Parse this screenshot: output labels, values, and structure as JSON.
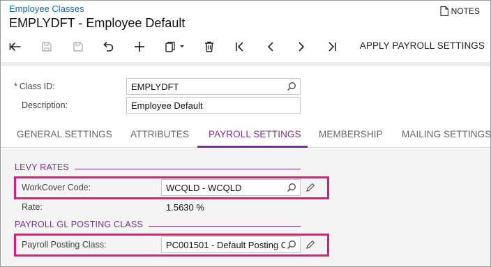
{
  "header": {
    "breadcrumb": "Employee Classes",
    "title": "EMPLYDFT - Employee Default",
    "notes_label": "NOTES"
  },
  "toolbar": {
    "buttons": [
      {
        "icon": "back-arrow-icon",
        "enabled": true
      },
      {
        "icon": "save-close-icon",
        "enabled": false
      },
      {
        "icon": "save-icon",
        "enabled": false
      },
      {
        "icon": "undo-icon",
        "enabled": true
      },
      {
        "icon": "add-icon",
        "enabled": true
      },
      {
        "icon": "copy-paste-icon",
        "enabled": true
      },
      {
        "icon": "delete-icon",
        "enabled": true
      },
      {
        "icon": "first-record-icon",
        "enabled": true
      },
      {
        "icon": "previous-record-icon",
        "enabled": true
      },
      {
        "icon": "next-record-icon",
        "enabled": true
      },
      {
        "icon": "last-record-icon",
        "enabled": true
      }
    ],
    "apply_label": "APPLY PAYROLL SETTINGS"
  },
  "form": {
    "required_mark": "*",
    "class_id_label": "Class ID:",
    "class_id_value": "EMPLYDFT",
    "description_label": "Description:",
    "description_value": "Employee Default"
  },
  "tabs": [
    {
      "label": "GENERAL SETTINGS",
      "active": false
    },
    {
      "label": "ATTRIBUTES",
      "active": false
    },
    {
      "label": "PAYROLL SETTINGS",
      "active": true
    },
    {
      "label": "MEMBERSHIP",
      "active": false
    },
    {
      "label": "MAILING SETTINGS",
      "active": false
    }
  ],
  "levy": {
    "section_title": "LEVY RATES",
    "workcover_label": "WorkCover Code:",
    "workcover_value": "WCQLD - WCQLD",
    "rate_label": "Rate:",
    "rate_value": "1.5630 %"
  },
  "gl": {
    "section_title": "PAYROLL GL POSTING CLASS",
    "posting_label": "Payroll Posting Class:",
    "posting_value": "PC001501 - Default Posting C"
  },
  "colors": {
    "accent": "#7b2d9c",
    "highlight": "#e6177a",
    "link": "#1565c0"
  }
}
